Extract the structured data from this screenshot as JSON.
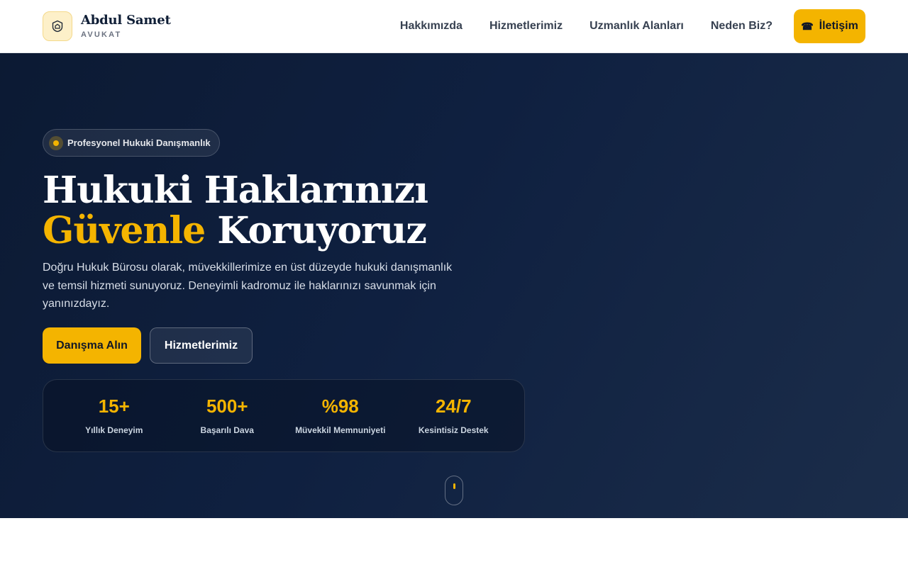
{
  "brand": {
    "name": "Abdul Samet",
    "subtitle": "AVUKAT",
    "logo_icon": "shield-home-icon"
  },
  "nav": {
    "items": [
      {
        "label": "Hakkımızda"
      },
      {
        "label": "Hizmetlerimiz"
      },
      {
        "label": "Uzmanlık Alanları"
      },
      {
        "label": "Neden Biz?"
      }
    ],
    "contact_label": "İletişim",
    "contact_icon": "phone-icon"
  },
  "hero": {
    "badge": "Profesyonel Hukuki Danışmanlık",
    "headline_line1": "Hukuki Haklarınızı",
    "headline_accent": "Güvenle",
    "headline_rest": " Koruyoruz",
    "description": "Doğru Hukuk Bürosu olarak, müvekkillerimize en üst düzeyde hukuki danışmanlık ve temsil hizmeti sunuyoruz. Deneyimli kadromuz ile haklarınızı savunmak için yanınızdayız.",
    "primary_button": "Danışma Alın",
    "secondary_button": "Hizmetlerimiz"
  },
  "stats": [
    {
      "value": "15+",
      "label": "Yıllık Deneyim"
    },
    {
      "value": "500+",
      "label": "Başarılı Dava"
    },
    {
      "value": "%98",
      "label": "Müvekkil Memnuniyeti"
    },
    {
      "value": "24/7",
      "label": "Kesintisiz Destek"
    }
  ],
  "colors": {
    "accent": "#f4b400",
    "hero_bg": "#0f2040",
    "text_dark": "#0f1e36"
  }
}
